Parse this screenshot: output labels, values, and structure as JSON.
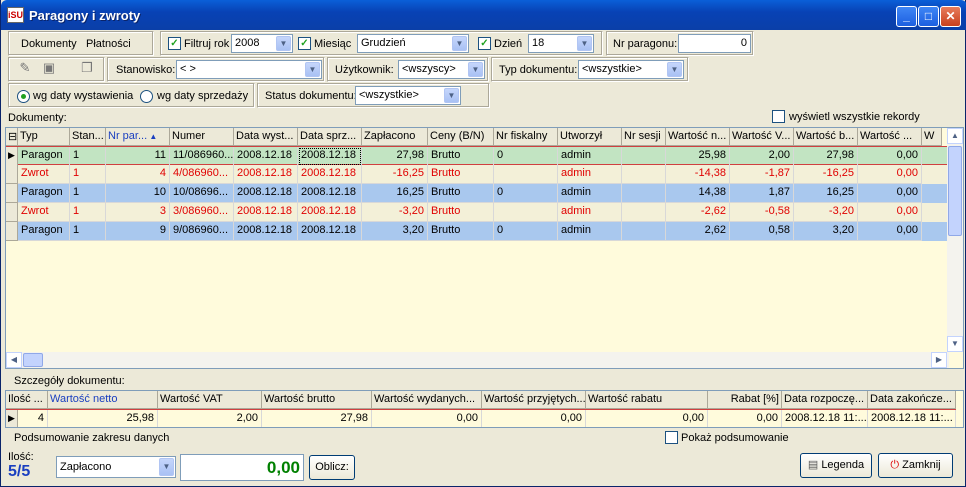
{
  "window": {
    "title": "Paragony i zwroty",
    "app_icon": "iSU"
  },
  "toolbar": {
    "dokumenty": "Dokumenty",
    "platnosci": "Płatności",
    "filtruj_rok": "Filtruj rok",
    "rok": "2008",
    "miesiac_label": "Miesiąc",
    "miesiac": "Grudzień",
    "dzien_label": "Dzień",
    "dzien": "18",
    "nr_paragonu_label": "Nr paragonu:",
    "nr_paragonu": "0",
    "stanowisko_label": "Stanowisko:",
    "stanowisko": "< >",
    "uzytkownik_label": "Użytkownik:",
    "uzytkownik": "<wszyscy>",
    "typ_label": "Typ dokumentu:",
    "typ": "<wszystkie>",
    "wg_wystawienia": "wg daty wystawienia",
    "wg_sprzedazy": "wg daty sprzedaży",
    "status_label": "Status dokumentu:",
    "status": "<wszystkie>"
  },
  "documents": {
    "label": "Dokumenty:",
    "show_all": "wyświetl wszystkie rekordy",
    "columns": [
      "Typ",
      "Stan...",
      "Nr par...",
      "Numer",
      "Data wyst...",
      "Data sprz...",
      "Zapłacono",
      "Ceny (B/N)",
      "Nr fiskalny",
      "Utworzył",
      "Nr sesji",
      "Wartość n...",
      "Wartość V...",
      "Wartość b...",
      "Wartość ...",
      "W"
    ],
    "rows": [
      [
        "Paragon",
        "1",
        "11",
        "11/086960...",
        "2008.12.18",
        "2008.12.18",
        "27,98",
        "Brutto",
        "0",
        "admin",
        "",
        "25,98",
        "2,00",
        "27,98",
        "0,00"
      ],
      [
        "Zwrot",
        "1",
        "4",
        "4/086960...",
        "2008.12.18",
        "2008.12.18",
        "-16,25",
        "Brutto",
        "",
        "admin",
        "",
        "-14,38",
        "-1,87",
        "-16,25",
        "0,00"
      ],
      [
        "Paragon",
        "1",
        "10",
        "10/08696...",
        "2008.12.18",
        "2008.12.18",
        "16,25",
        "Brutto",
        "0",
        "admin",
        "",
        "14,38",
        "1,87",
        "16,25",
        "0,00"
      ],
      [
        "Zwrot",
        "1",
        "3",
        "3/086960...",
        "2008.12.18",
        "2008.12.18",
        "-3,20",
        "Brutto",
        "",
        "admin",
        "",
        "-2,62",
        "-0,58",
        "-3,20",
        "0,00"
      ],
      [
        "Paragon",
        "1",
        "9",
        "9/086960...",
        "2008.12.18",
        "2008.12.18",
        "3,20",
        "Brutto",
        "0",
        "admin",
        "",
        "2,62",
        "0,58",
        "3,20",
        "0,00"
      ]
    ]
  },
  "details": {
    "label": "Szczegóły dokumentu:",
    "columns": [
      "Ilość ...",
      "Wartość netto",
      "Wartość VAT",
      "Wartość brutto",
      "Wartość wydanych...",
      "Wartość przyjętych...",
      "Wartość rabatu",
      "Rabat [%]",
      "Data rozpoczę...",
      "Data zakończe..."
    ],
    "row": [
      "4",
      "25,98",
      "2,00",
      "27,98",
      "0,00",
      "0,00",
      "0,00",
      "0,00",
      "2008.12.18 11:...",
      "2008.12.18 11:..."
    ]
  },
  "summary": {
    "label": "Podsumowanie zakresu danych",
    "show_label": "Pokaż podsumowanie",
    "ilosc_label": "Ilość:",
    "ilosc": "5/5",
    "field": "Zapłacono",
    "value": "0,00",
    "oblicz": "Oblicz:",
    "legenda": "Legenda",
    "zamknij": "Zamknij"
  },
  "colors": {
    "paragon_green": "#c2e4c2",
    "paragon_blue": "#a9c8ee",
    "zwrot_bg": "#f3f0d8",
    "zwrot_text": "#e00000",
    "value_green": "#008000",
    "ilosc_blue": "#1a3fc0"
  }
}
